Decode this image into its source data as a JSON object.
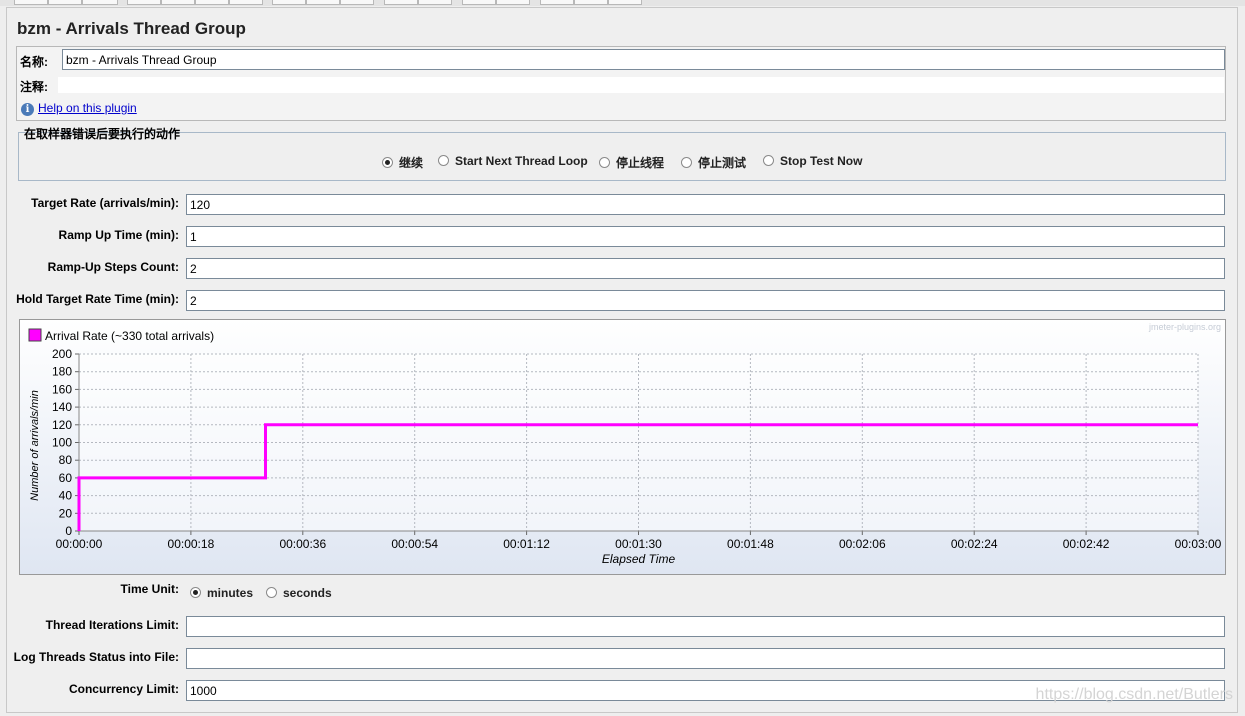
{
  "window": {
    "title": "bzm - Arrivals Thread Group"
  },
  "name_section": {
    "name_label": "名称:",
    "name_value": "bzm - Arrivals Thread Group",
    "comment_label": "注释:",
    "comment_value": "",
    "help_link": "Help on this plugin"
  },
  "error_action": {
    "title": "在取样器错误后要执行的动作",
    "options": [
      "继续",
      "Start Next Thread Loop",
      "停止线程",
      "停止测试",
      "Stop Test Now"
    ],
    "selected": "继续"
  },
  "params": [
    {
      "label": "Target Rate (arrivals/min):",
      "value": "120"
    },
    {
      "label": "Ramp Up Time (min):",
      "value": "1"
    },
    {
      "label": "Ramp-Up Steps Count:",
      "value": "2"
    },
    {
      "label": "Hold Target Rate Time (min):",
      "value": "2"
    }
  ],
  "chart_data": {
    "type": "line",
    "title": "",
    "legend": "Arrival Rate (~330 total arrivals)",
    "watermark": "jmeter-plugins.org",
    "xlabel": "Elapsed Time",
    "ylabel": "Number of arrivals/min",
    "ylim": [
      0,
      200
    ],
    "xlim_seconds": [
      0,
      180
    ],
    "y_ticks": [
      "0",
      "20",
      "40",
      "60",
      "80",
      "100",
      "120",
      "140",
      "160",
      "180",
      "200"
    ],
    "x_ticks": [
      "00:00:00",
      "00:00:18",
      "00:00:36",
      "00:00:54",
      "00:01:12",
      "00:01:30",
      "00:01:48",
      "00:02:06",
      "00:02:24",
      "00:02:42",
      "00:03:00"
    ],
    "grid": true,
    "legend_position": "top-left",
    "series": [
      {
        "name": "Arrival Rate (~330 total arrivals)",
        "color": "#ff00ff",
        "x_seconds": [
          0,
          0,
          30,
          30,
          180
        ],
        "y": [
          0,
          60,
          60,
          120,
          120
        ]
      }
    ]
  },
  "time_unit": {
    "label": "Time Unit:",
    "options": [
      "minutes",
      "seconds"
    ],
    "selected": "minutes"
  },
  "extra_params": [
    {
      "label": "Thread Iterations Limit:",
      "value": ""
    },
    {
      "label": "Log Threads Status into File:",
      "value": ""
    },
    {
      "label": "Concurrency Limit:",
      "value": "1000"
    }
  ],
  "blog_watermark": "https://blog.csdn.net/Butlers"
}
